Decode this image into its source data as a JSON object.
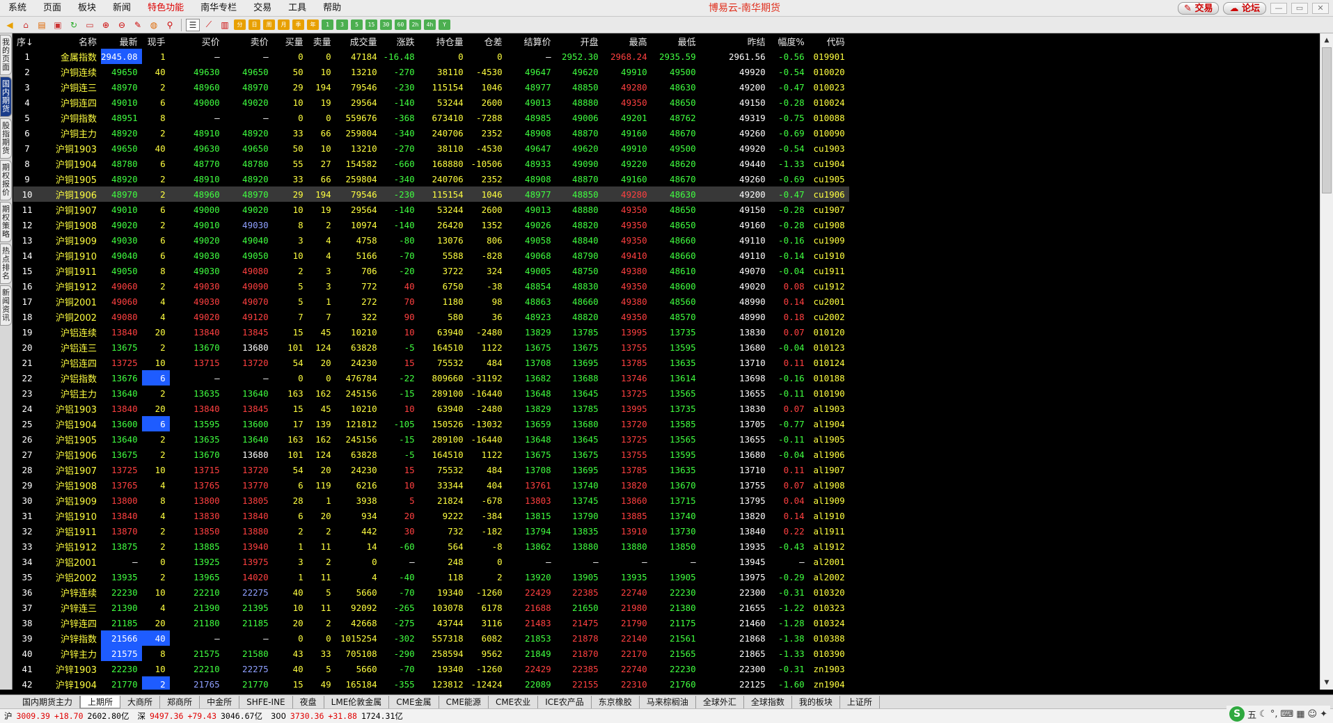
{
  "menu": [
    "系统",
    "页面",
    "板块",
    "新闻",
    "特色功能",
    "南华专栏",
    "交易",
    "工具",
    "帮助"
  ],
  "menu_active_index": 4,
  "app_title": "博易云-南华期货",
  "top_buttons": {
    "trade": "交易",
    "forum": "论坛"
  },
  "toolbar_periods": [
    "分",
    "日",
    "周",
    "月",
    "季",
    "年",
    "1",
    "3",
    "5",
    "15",
    "30",
    "60",
    "2h",
    "4h",
    "Y"
  ],
  "side_tabs": [
    {
      "label": "我的页面",
      "active": false
    },
    {
      "label": "国内期货",
      "active": true
    },
    {
      "label": "股指期货",
      "active": false
    },
    {
      "label": "期权报价",
      "active": false
    },
    {
      "label": "期权策略",
      "active": false
    },
    {
      "label": "热点排名",
      "active": false
    },
    {
      "label": "新闻资讯",
      "active": false
    }
  ],
  "columns": [
    "序↓",
    "名称",
    "最新",
    "现手",
    "买价",
    "卖价",
    "买量",
    "卖量",
    "成交量",
    "涨跌",
    "持仓量",
    "仓差",
    "结算价",
    "开盘",
    "最高",
    "最低",
    "昨结",
    "幅度%",
    "代码"
  ],
  "selected_row": 10,
  "rows": [
    [
      "1",
      "金属指数",
      "2945.08",
      "1",
      "—",
      "—",
      "0",
      "0",
      "47184",
      "-16.48",
      "0",
      "0",
      "—",
      "2952.30",
      "2968.24",
      "2935.59",
      "2961.56",
      "-0.56",
      "019901"
    ],
    [
      "2",
      "沪铜连续",
      "49650",
      "40",
      "49630",
      "49650",
      "50",
      "10",
      "13210",
      "-270",
      "38110",
      "-4530",
      "49647",
      "49620",
      "49910",
      "49500",
      "49920",
      "-0.54",
      "010020"
    ],
    [
      "3",
      "沪铜连三",
      "48970",
      "2",
      "48960",
      "48970",
      "29",
      "194",
      "79546",
      "-230",
      "115154",
      "1046",
      "48977",
      "48850",
      "49280",
      "48630",
      "49200",
      "-0.47",
      "010023"
    ],
    [
      "4",
      "沪铜连四",
      "49010",
      "6",
      "49000",
      "49020",
      "10",
      "19",
      "29564",
      "-140",
      "53244",
      "2600",
      "49013",
      "48880",
      "49350",
      "48650",
      "49150",
      "-0.28",
      "010024"
    ],
    [
      "5",
      "沪铜指数",
      "48951",
      "8",
      "—",
      "—",
      "0",
      "0",
      "559676",
      "-368",
      "673410",
      "-7288",
      "48985",
      "49006",
      "49201",
      "48762",
      "49319",
      "-0.75",
      "010088"
    ],
    [
      "6",
      "沪铜主力",
      "48920",
      "2",
      "48910",
      "48920",
      "33",
      "66",
      "259804",
      "-340",
      "240706",
      "2352",
      "48908",
      "48870",
      "49160",
      "48670",
      "49260",
      "-0.69",
      "010090"
    ],
    [
      "7",
      "沪铜1903",
      "49650",
      "40",
      "49630",
      "49650",
      "50",
      "10",
      "13210",
      "-270",
      "38110",
      "-4530",
      "49647",
      "49620",
      "49910",
      "49500",
      "49920",
      "-0.54",
      "cu1903"
    ],
    [
      "8",
      "沪铜1904",
      "48780",
      "6",
      "48770",
      "48780",
      "55",
      "27",
      "154582",
      "-660",
      "168880",
      "-10506",
      "48933",
      "49090",
      "49220",
      "48620",
      "49440",
      "-1.33",
      "cu1904"
    ],
    [
      "9",
      "沪铜1905",
      "48920",
      "2",
      "48910",
      "48920",
      "33",
      "66",
      "259804",
      "-340",
      "240706",
      "2352",
      "48908",
      "48870",
      "49160",
      "48670",
      "49260",
      "-0.69",
      "cu1905"
    ],
    [
      "10",
      "沪铜1906",
      "48970",
      "2",
      "48960",
      "48970",
      "29",
      "194",
      "79546",
      "-230",
      "115154",
      "1046",
      "48977",
      "48850",
      "49280",
      "48630",
      "49200",
      "-0.47",
      "cu1906"
    ],
    [
      "11",
      "沪铜1907",
      "49010",
      "6",
      "49000",
      "49020",
      "10",
      "19",
      "29564",
      "-140",
      "53244",
      "2600",
      "49013",
      "48880",
      "49350",
      "48650",
      "49150",
      "-0.28",
      "cu1907"
    ],
    [
      "12",
      "沪铜1908",
      "49020",
      "2",
      "49010",
      "49030",
      "8",
      "2",
      "10974",
      "-140",
      "26420",
      "1352",
      "49026",
      "48820",
      "49350",
      "48650",
      "49160",
      "-0.28",
      "cu1908"
    ],
    [
      "13",
      "沪铜1909",
      "49030",
      "6",
      "49020",
      "49040",
      "3",
      "4",
      "4758",
      "-80",
      "13076",
      "806",
      "49058",
      "48840",
      "49350",
      "48660",
      "49110",
      "-0.16",
      "cu1909"
    ],
    [
      "14",
      "沪铜1910",
      "49040",
      "6",
      "49030",
      "49050",
      "10",
      "4",
      "5166",
      "-70",
      "5588",
      "-828",
      "49068",
      "48790",
      "49410",
      "48660",
      "49110",
      "-0.14",
      "cu1910"
    ],
    [
      "15",
      "沪铜1911",
      "49050",
      "8",
      "49030",
      "49080",
      "2",
      "3",
      "706",
      "-20",
      "3722",
      "324",
      "49005",
      "48750",
      "49380",
      "48610",
      "49070",
      "-0.04",
      "cu1911"
    ],
    [
      "16",
      "沪铜1912",
      "49060",
      "2",
      "49030",
      "49090",
      "5",
      "3",
      "772",
      "40",
      "6750",
      "-38",
      "48854",
      "48830",
      "49350",
      "48600",
      "49020",
      "0.08",
      "cu1912"
    ],
    [
      "17",
      "沪铜2001",
      "49060",
      "4",
      "49030",
      "49070",
      "5",
      "1",
      "272",
      "70",
      "1180",
      "98",
      "48863",
      "48660",
      "49380",
      "48560",
      "48990",
      "0.14",
      "cu2001"
    ],
    [
      "18",
      "沪铜2002",
      "49080",
      "4",
      "49020",
      "49120",
      "7",
      "7",
      "322",
      "90",
      "580",
      "36",
      "48923",
      "48820",
      "49350",
      "48570",
      "48990",
      "0.18",
      "cu2002"
    ],
    [
      "19",
      "沪铝连续",
      "13840",
      "20",
      "13840",
      "13845",
      "15",
      "45",
      "10210",
      "10",
      "63940",
      "-2480",
      "13829",
      "13785",
      "13995",
      "13735",
      "13830",
      "0.07",
      "010120"
    ],
    [
      "20",
      "沪铝连三",
      "13675",
      "2",
      "13670",
      "13680",
      "101",
      "124",
      "63828",
      "-5",
      "164510",
      "1122",
      "13675",
      "13675",
      "13755",
      "13595",
      "13680",
      "-0.04",
      "010123"
    ],
    [
      "21",
      "沪铝连四",
      "13725",
      "10",
      "13715",
      "13720",
      "54",
      "20",
      "24230",
      "15",
      "75532",
      "484",
      "13708",
      "13695",
      "13785",
      "13635",
      "13710",
      "0.11",
      "010124"
    ],
    [
      "22",
      "沪铝指数",
      "13676",
      "6",
      "—",
      "—",
      "0",
      "0",
      "476784",
      "-22",
      "809660",
      "-31192",
      "13682",
      "13688",
      "13746",
      "13614",
      "13698",
      "-0.16",
      "010188"
    ],
    [
      "23",
      "沪铝主力",
      "13640",
      "2",
      "13635",
      "13640",
      "163",
      "162",
      "245156",
      "-15",
      "289100",
      "-16440",
      "13648",
      "13645",
      "13725",
      "13565",
      "13655",
      "-0.11",
      "010190"
    ],
    [
      "24",
      "沪铝1903",
      "13840",
      "20",
      "13840",
      "13845",
      "15",
      "45",
      "10210",
      "10",
      "63940",
      "-2480",
      "13829",
      "13785",
      "13995",
      "13735",
      "13830",
      "0.07",
      "al1903"
    ],
    [
      "25",
      "沪铝1904",
      "13600",
      "6",
      "13595",
      "13600",
      "17",
      "139",
      "121812",
      "-105",
      "150526",
      "-13032",
      "13659",
      "13680",
      "13720",
      "13585",
      "13705",
      "-0.77",
      "al1904"
    ],
    [
      "26",
      "沪铝1905",
      "13640",
      "2",
      "13635",
      "13640",
      "163",
      "162",
      "245156",
      "-15",
      "289100",
      "-16440",
      "13648",
      "13645",
      "13725",
      "13565",
      "13655",
      "-0.11",
      "al1905"
    ],
    [
      "27",
      "沪铝1906",
      "13675",
      "2",
      "13670",
      "13680",
      "101",
      "124",
      "63828",
      "-5",
      "164510",
      "1122",
      "13675",
      "13675",
      "13755",
      "13595",
      "13680",
      "-0.04",
      "al1906"
    ],
    [
      "28",
      "沪铝1907",
      "13725",
      "10",
      "13715",
      "13720",
      "54",
      "20",
      "24230",
      "15",
      "75532",
      "484",
      "13708",
      "13695",
      "13785",
      "13635",
      "13710",
      "0.11",
      "al1907"
    ],
    [
      "29",
      "沪铝1908",
      "13765",
      "4",
      "13765",
      "13770",
      "6",
      "119",
      "6216",
      "10",
      "33344",
      "404",
      "13761",
      "13740",
      "13820",
      "13670",
      "13755",
      "0.07",
      "al1908"
    ],
    [
      "30",
      "沪铝1909",
      "13800",
      "8",
      "13800",
      "13805",
      "28",
      "1",
      "3938",
      "5",
      "21824",
      "-678",
      "13803",
      "13745",
      "13860",
      "13715",
      "13795",
      "0.04",
      "al1909"
    ],
    [
      "31",
      "沪铝1910",
      "13840",
      "4",
      "13830",
      "13840",
      "6",
      "20",
      "934",
      "20",
      "9222",
      "-384",
      "13815",
      "13790",
      "13885",
      "13740",
      "13820",
      "0.14",
      "al1910"
    ],
    [
      "32",
      "沪铝1911",
      "13870",
      "2",
      "13850",
      "13880",
      "2",
      "2",
      "442",
      "30",
      "732",
      "-182",
      "13794",
      "13835",
      "13910",
      "13730",
      "13840",
      "0.22",
      "al1911"
    ],
    [
      "33",
      "沪铝1912",
      "13875",
      "2",
      "13885",
      "13940",
      "1",
      "11",
      "14",
      "-60",
      "564",
      "-8",
      "13862",
      "13880",
      "13880",
      "13850",
      "13935",
      "-0.43",
      "al1912"
    ],
    [
      "34",
      "沪铝2001",
      "—",
      "0",
      "13925",
      "13975",
      "3",
      "2",
      "0",
      "—",
      "248",
      "0",
      "—",
      "—",
      "—",
      "—",
      "13945",
      "—",
      "al2001"
    ],
    [
      "35",
      "沪铝2002",
      "13935",
      "2",
      "13965",
      "14020",
      "1",
      "11",
      "4",
      "-40",
      "118",
      "2",
      "13920",
      "13905",
      "13935",
      "13905",
      "13975",
      "-0.29",
      "al2002"
    ],
    [
      "36",
      "沪锌连续",
      "22230",
      "10",
      "22210",
      "22275",
      "40",
      "5",
      "5660",
      "-70",
      "19340",
      "-1260",
      "22429",
      "22385",
      "22740",
      "22230",
      "22300",
      "-0.31",
      "010320"
    ],
    [
      "37",
      "沪锌连三",
      "21390",
      "4",
      "21390",
      "21395",
      "10",
      "11",
      "92092",
      "-265",
      "103078",
      "6178",
      "21688",
      "21650",
      "21980",
      "21380",
      "21655",
      "-1.22",
      "010323"
    ],
    [
      "38",
      "沪锌连四",
      "21185",
      "20",
      "21180",
      "21185",
      "20",
      "2",
      "42668",
      "-275",
      "43744",
      "3116",
      "21483",
      "21475",
      "21790",
      "21175",
      "21460",
      "-1.28",
      "010324"
    ],
    [
      "39",
      "沪锌指数",
      "21566",
      "40",
      "—",
      "—",
      "0",
      "0",
      "1015254",
      "-302",
      "557318",
      "6082",
      "21853",
      "21878",
      "22140",
      "21561",
      "21868",
      "-1.38",
      "010388"
    ],
    [
      "40",
      "沪锌主力",
      "21575",
      "8",
      "21575",
      "21580",
      "43",
      "33",
      "705108",
      "-290",
      "258594",
      "9562",
      "21849",
      "21870",
      "22170",
      "21565",
      "21865",
      "-1.33",
      "010390"
    ],
    [
      "41",
      "沪锌1903",
      "22230",
      "10",
      "22210",
      "22275",
      "40",
      "5",
      "5660",
      "-70",
      "19340",
      "-1260",
      "22429",
      "22385",
      "22740",
      "22230",
      "22300",
      "-0.31",
      "zn1903"
    ],
    [
      "42",
      "沪锌1904",
      "21770",
      "2",
      "21765",
      "21770",
      "15",
      "49",
      "165184",
      "-355",
      "123812",
      "-12424",
      "22089",
      "22155",
      "22310",
      "21760",
      "22125",
      "-1.60",
      "zn1904"
    ]
  ],
  "highlight_cells": [
    [
      1,
      2
    ],
    [
      22,
      3
    ],
    [
      25,
      3
    ],
    [
      39,
      2
    ],
    [
      39,
      3
    ],
    [
      40,
      2
    ],
    [
      42,
      3
    ]
  ],
  "bluish_cells": [
    [
      12,
      5
    ],
    [
      36,
      5
    ],
    [
      41,
      5
    ],
    [
      42,
      4
    ]
  ],
  "market_tabs": [
    "国内期货主力",
    "上期所",
    "大商所",
    "郑商所",
    "中金所",
    "SHFE-INE",
    "夜盘",
    "LME伦敦金属",
    "CME金属",
    "CME能源",
    "CME农业",
    "ICE农产品",
    "东京橡胶",
    "马来棕榈油",
    "全球外汇",
    "全球指数",
    "我的板块",
    "上证所"
  ],
  "market_tab_active": 1,
  "status": {
    "sh_label": "沪",
    "sh_index": "3009.39",
    "sh_change": "+18.70",
    "sh_amount": "2602.80亿",
    "sz_label": "深",
    "sz_index": "9497.36",
    "sz_change": "+79.43",
    "sz_amount": "3046.67亿",
    "hs_label": "300",
    "hs_index": "3730.36",
    "hs_change": "+31.88",
    "hs_amount": "1724.31亿"
  },
  "ime": {
    "logo": "S",
    "label": "五"
  },
  "colors": {
    "up": "#ff4040",
    "down": "#40ff40",
    "flat": "#ffffff",
    "name": "#ffff40",
    "highlight": "#1e5cff",
    "title": "#e0301e"
  }
}
